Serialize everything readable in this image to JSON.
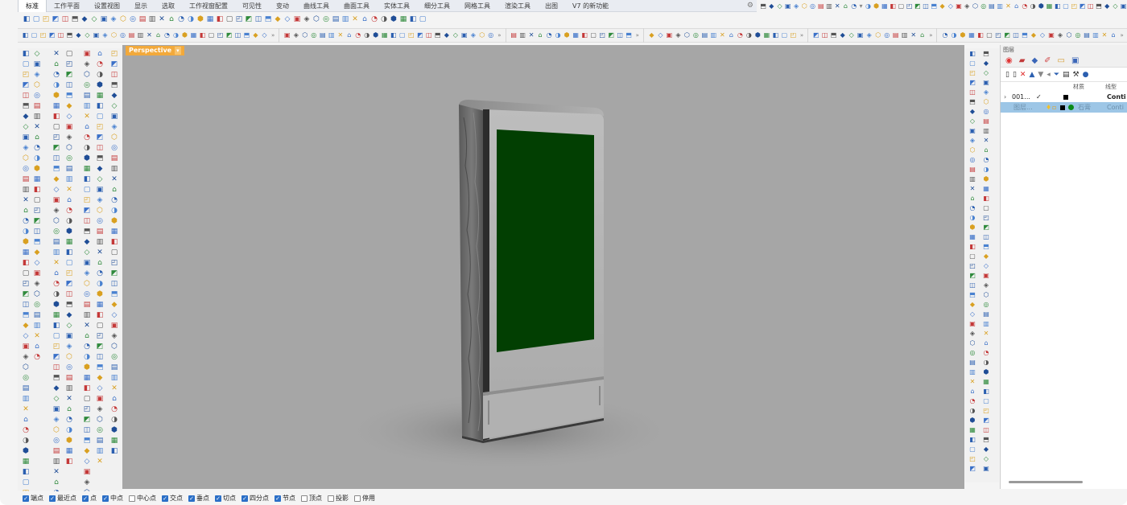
{
  "menu_tabs": [
    "标准",
    "工作平面",
    "设置视图",
    "显示",
    "选取",
    "工作视窗配置",
    "可见性",
    "变动",
    "曲线工具",
    "曲面工具",
    "实体工具",
    "细分工具",
    "网格工具",
    "渲染工具",
    "出图",
    "V7 的新功能"
  ],
  "active_tab_index": 0,
  "viewport": {
    "label": "Perspective"
  },
  "layers_panel": {
    "title": "图层",
    "columns": {
      "material": "材质",
      "linetype": "线型"
    },
    "rows": [
      {
        "name": "001...",
        "check": "✓",
        "linetype": "Conti"
      },
      {
        "name": "图层...",
        "material": "石膏",
        "linetype": "Conti"
      }
    ]
  },
  "osnaps": [
    {
      "label": "端点",
      "checked": true
    },
    {
      "label": "最近点",
      "checked": true
    },
    {
      "label": "点",
      "checked": true
    },
    {
      "label": "中点",
      "checked": true
    },
    {
      "label": "中心点",
      "checked": false
    },
    {
      "label": "交点",
      "checked": true
    },
    {
      "label": "垂点",
      "checked": true
    },
    {
      "label": "切点",
      "checked": true
    },
    {
      "label": "四分点",
      "checked": true
    },
    {
      "label": "节点",
      "checked": true
    },
    {
      "label": "顶点",
      "checked": false
    },
    {
      "label": "投影",
      "checked": false
    },
    {
      "label": "停用",
      "checked": false
    }
  ],
  "colors": {
    "viewport_bg": "#a6a6a6",
    "screen_green": "#023f02",
    "viewport_label_bg": "#f2a93b",
    "selected_layer_bg": "#9dc6e6",
    "checkbox_blue": "#2b6fc7"
  },
  "icons": {
    "toolbar": "rhino-command-icons",
    "layer_visible": "bulb-icon",
    "layer_lock": "lock-icon"
  }
}
